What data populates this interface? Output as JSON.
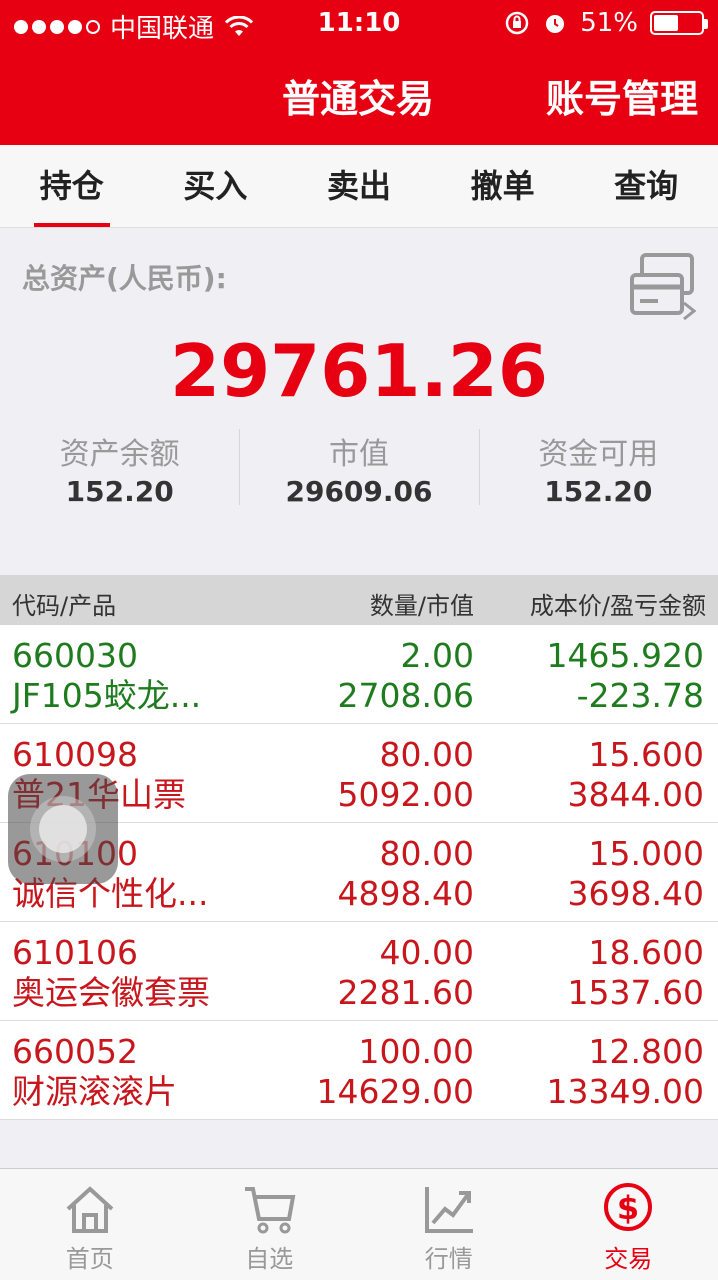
{
  "status_bar": {
    "carrier": "中国联通",
    "time": "11:10",
    "battery": "51%",
    "icons": [
      "signal-icon",
      "wifi-icon",
      "rotation-lock-icon",
      "alarm-icon",
      "battery-icon"
    ]
  },
  "header": {
    "title": "普通交易",
    "account_mgmt": "账号管理"
  },
  "tabs": [
    {
      "label": "持仓",
      "active": true
    },
    {
      "label": "买入"
    },
    {
      "label": "卖出"
    },
    {
      "label": "撤单"
    },
    {
      "label": "查询"
    }
  ],
  "summary": {
    "total_label": "总资产(人民币):",
    "total_value": "29761.26",
    "stats": [
      {
        "label": "资产余额",
        "value": "152.20"
      },
      {
        "label": "市值",
        "value": "29609.06"
      },
      {
        "label": "资金可用",
        "value": "152.20"
      }
    ]
  },
  "table": {
    "headers": [
      "代码/产品",
      "数量/市值",
      "成本价/盈亏金额"
    ],
    "rows": [
      {
        "code": "660030",
        "name": "JF105蛟龙...",
        "qty": "2.00",
        "mkt": "2708.06",
        "cost": "1465.920",
        "pnl": "-223.78",
        "color": "green"
      },
      {
        "code": "610098",
        "name": "普21华山票",
        "qty": "80.00",
        "mkt": "5092.00",
        "cost": "15.600",
        "pnl": "3844.00",
        "color": "red"
      },
      {
        "code": "610100",
        "name": "诚信个性化...",
        "qty": "80.00",
        "mkt": "4898.40",
        "cost": "15.000",
        "pnl": "3698.40",
        "color": "red"
      },
      {
        "code": "610106",
        "name": "奥运会徽套票",
        "qty": "40.00",
        "mkt": "2281.60",
        "cost": "18.600",
        "pnl": "1537.60",
        "color": "red"
      },
      {
        "code": "660052",
        "name": "财源滚滚片",
        "qty": "100.00",
        "mkt": "14629.00",
        "cost": "12.800",
        "pnl": "13349.00",
        "color": "red"
      }
    ]
  },
  "bottom_nav": [
    {
      "label": "首页",
      "icon": "home-icon"
    },
    {
      "label": "自选",
      "icon": "cart-icon"
    },
    {
      "label": "行情",
      "icon": "chart-icon"
    },
    {
      "label": "交易",
      "icon": "dollar-icon",
      "active": true
    }
  ],
  "colors": {
    "brand_red": "#e60012",
    "gain_red": "#c8161d",
    "loss_green": "#1e7b1e"
  }
}
